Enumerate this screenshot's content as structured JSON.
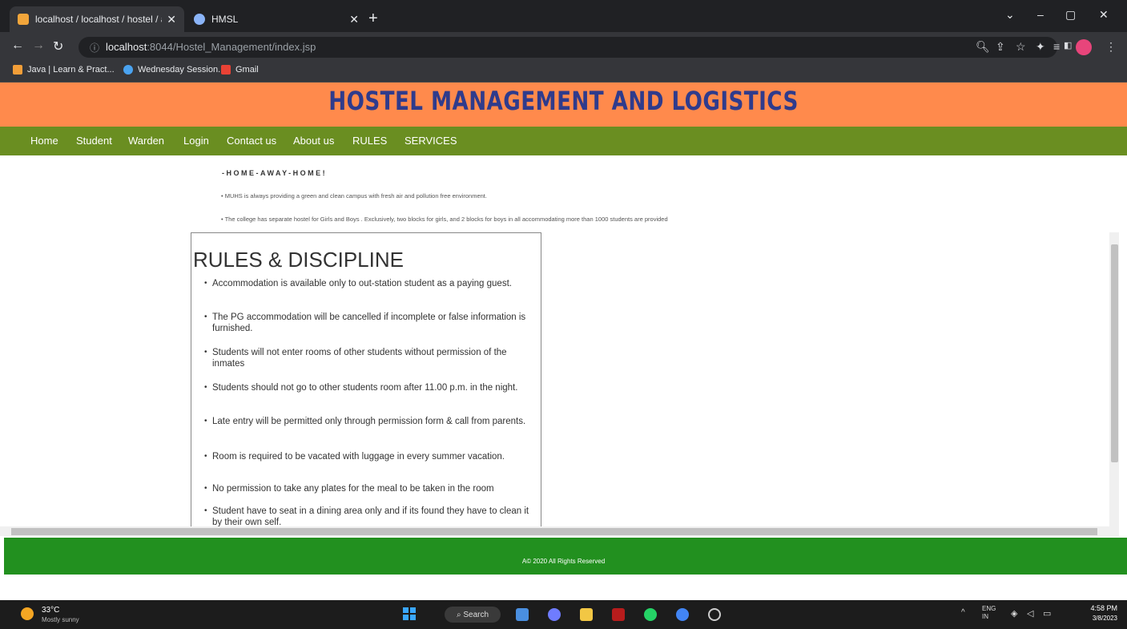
{
  "browser": {
    "tabs": [
      {
        "title": "localhost / localhost / hostel / ac"
      },
      {
        "title": "HMSL"
      }
    ],
    "new_tab": "+",
    "controls": {
      "minimize": "–",
      "maximize": "▢",
      "close": "✕"
    },
    "url_host": "localhost",
    "url_path": ":8044/Hostel_Management/index.jsp",
    "bookmarks": [
      "Java | Learn & Pract...",
      "Wednesday Session...",
      "Gmail"
    ]
  },
  "site": {
    "title": "HOSTEL MANAGEMENT AND LOGISTICS",
    "nav": [
      "Home",
      "Student",
      "Warden",
      "Login",
      "Contact us",
      "About us",
      "RULES",
      "SERVICES"
    ],
    "tagline": "-HOME-AWAY-HOME!",
    "intro": [
      "• MUHS is always providing a green and clean campus with fresh air and pollution free environment.",
      "• The college has separate hostel for Girls and Boys . Exclusively, two blocks for girls, and 2 blocks for boys in all accommodating more than 1000 students are provided"
    ],
    "rules_title": "RULES & DISCIPLINE",
    "rules": [
      "Accommodation is available only to out-station student as a paying guest.",
      "The PG accommodation will be cancelled if incomplete or false information is furnished.",
      "Students will not enter rooms of other students without permission of the inmates",
      "Students should not go to other students room after 11.00 p.m. in the night.",
      "Late entry will be permitted only through permission form & call from parents.",
      "Room is required to be vacated with luggage in every summer vacation.",
      "No permission to take any plates for the meal to be taken in the room",
      "Student have to seat in a dining area only and if its found they have to clean it by their own self."
    ],
    "footer": "A© 2020 All Rights Reserved"
  },
  "taskbar": {
    "temp": "33°C",
    "weather": "Mostly sunny",
    "search": "Search",
    "lang": "ENG IN",
    "time": "4:58 PM",
    "date": "3/8/2023"
  }
}
